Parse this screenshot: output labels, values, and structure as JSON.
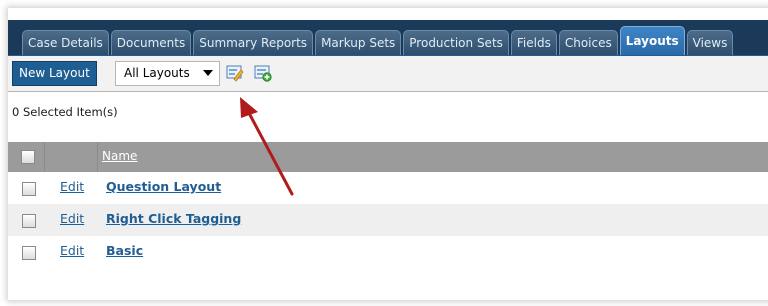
{
  "tabs": [
    {
      "label": "Case Details",
      "active": false
    },
    {
      "label": "Documents",
      "active": false
    },
    {
      "label": "Summary Reports",
      "active": false
    },
    {
      "label": "Markup Sets",
      "active": false
    },
    {
      "label": "Production Sets",
      "active": false
    },
    {
      "label": "Fields",
      "active": false
    },
    {
      "label": "Choices",
      "active": false
    },
    {
      "label": "Layouts",
      "active": true
    },
    {
      "label": "Views",
      "active": false
    }
  ],
  "toolbar": {
    "new_button": "New Layout",
    "filter_value": "All Layouts",
    "icons": [
      "edit-layout-icon",
      "add-layout-icon"
    ]
  },
  "selection": {
    "text": "0 Selected Item(s)"
  },
  "table": {
    "headers": [
      "",
      "",
      "Name"
    ],
    "rows": [
      {
        "action": "Edit",
        "name": "Question Layout"
      },
      {
        "action": "Edit",
        "name": "Right Click Tagging"
      },
      {
        "action": "Edit",
        "name": "Basic"
      }
    ]
  },
  "colors": {
    "tabbar_bg": "#1b3a5a",
    "active_tab": "#3e86c6",
    "link": "#1f5e93",
    "header_bg": "#9b9b9b",
    "arrow": "#b01c1c"
  }
}
